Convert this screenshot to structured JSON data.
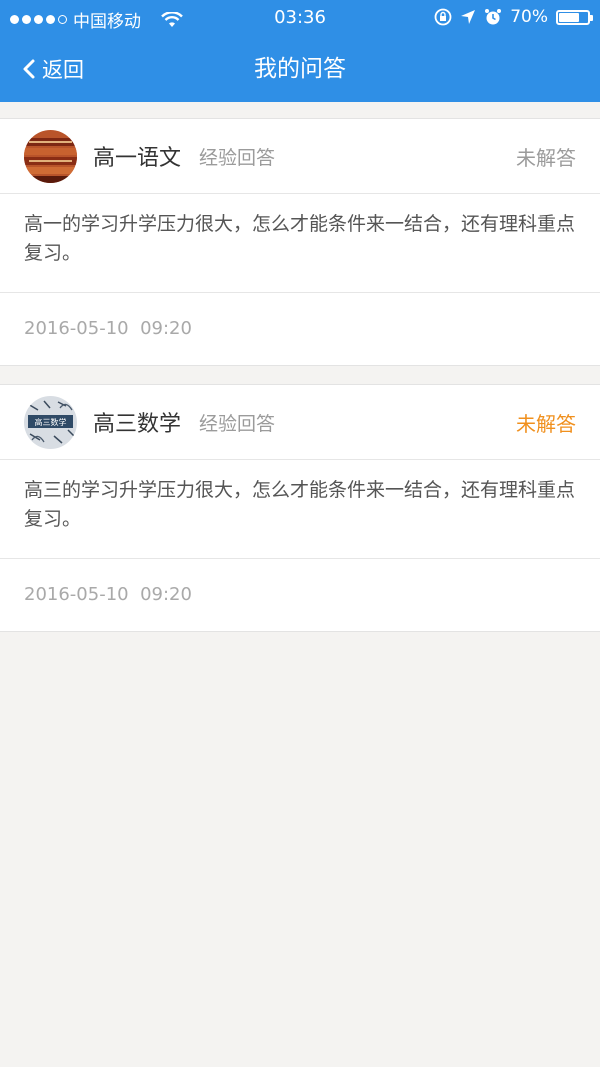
{
  "status_bar": {
    "carrier": "中国移动",
    "time": "03:36",
    "battery_text": "70%",
    "battery_level": 0.7
  },
  "nav": {
    "back_label": "返回",
    "title": "我的问答"
  },
  "questions": [
    {
      "subject": "高一语文",
      "tag": "经验回答",
      "status": "未解答",
      "status_color": "#9b9b9b",
      "text": "高一的学习升学压力很大，怎么才能条件来一结合，还有理科重点复习。",
      "date": "2016-05-10",
      "time": "09:20"
    },
    {
      "subject": "高三数学",
      "tag": "经验回答",
      "status": "未解答",
      "status_color": "#f0901e",
      "text": "高三的学习升学压力很大，怎么才能条件来一结合，还有理科重点复习。",
      "date": "2016-05-10",
      "time": "09:20",
      "avatar_text": "高三数学"
    }
  ],
  "colors": {
    "nav_blue": "#2f8fe6",
    "background": "#f4f3f1",
    "orange_status": "#f0901e"
  }
}
